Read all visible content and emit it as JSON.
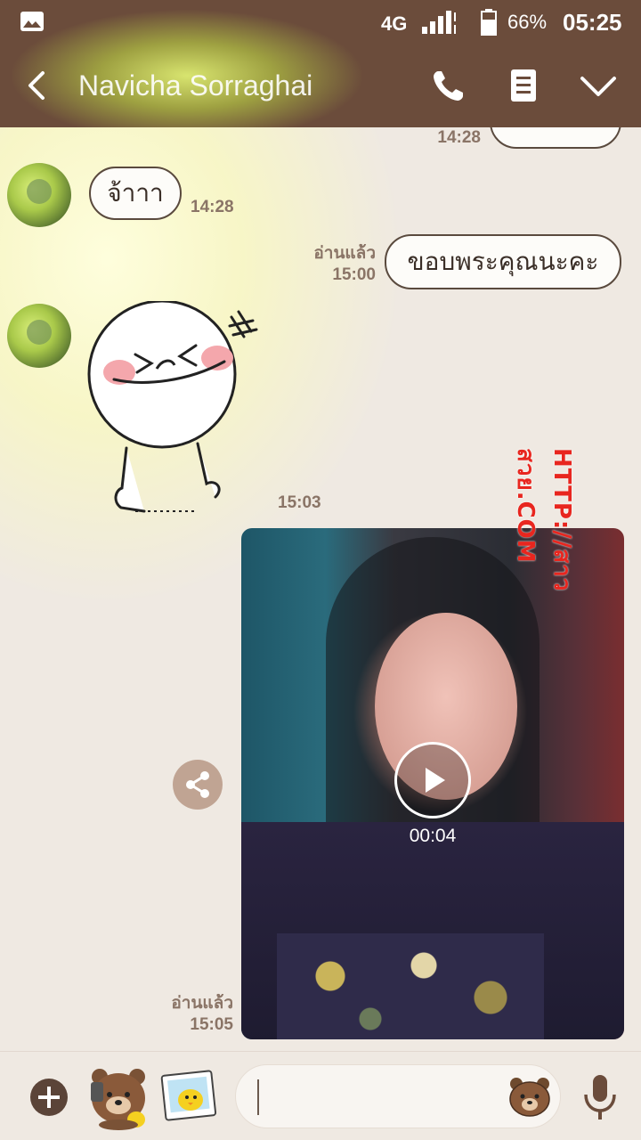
{
  "status_bar": {
    "network": "4G",
    "battery_percent": "66%",
    "time": "05:25"
  },
  "header": {
    "title": "Navicha Sorraghai",
    "icons": [
      "back-icon",
      "phone-icon",
      "notes-icon",
      "chevron-down-icon"
    ]
  },
  "messages": [
    {
      "side": "right",
      "type": "text",
      "time": "14:28",
      "partial": true
    },
    {
      "side": "left",
      "type": "text",
      "text": "จ้าาา",
      "time": "14:28"
    },
    {
      "side": "right",
      "type": "text",
      "text": "ขอบพระคุณนะคะ",
      "read": "อ่านแล้ว",
      "time": "15:00"
    },
    {
      "side": "left",
      "type": "sticker",
      "time": "15:03"
    },
    {
      "side": "right",
      "type": "video",
      "duration": "00:04",
      "read": "อ่านแล้ว",
      "time": "15:05"
    }
  ],
  "watermark": "HTTP://สาวสวย.COM",
  "input_bar": {
    "placeholder": "",
    "icons": [
      "plus-icon",
      "sticker-icon",
      "photo-icon",
      "emoji-icon",
      "mic-icon"
    ]
  },
  "colors": {
    "header_bg": "#6b4c3b",
    "chat_bg": "#efe9e2",
    "bubble_border": "#5a4a3e",
    "time_text": "#8a7466",
    "watermark": "#e8261f"
  }
}
